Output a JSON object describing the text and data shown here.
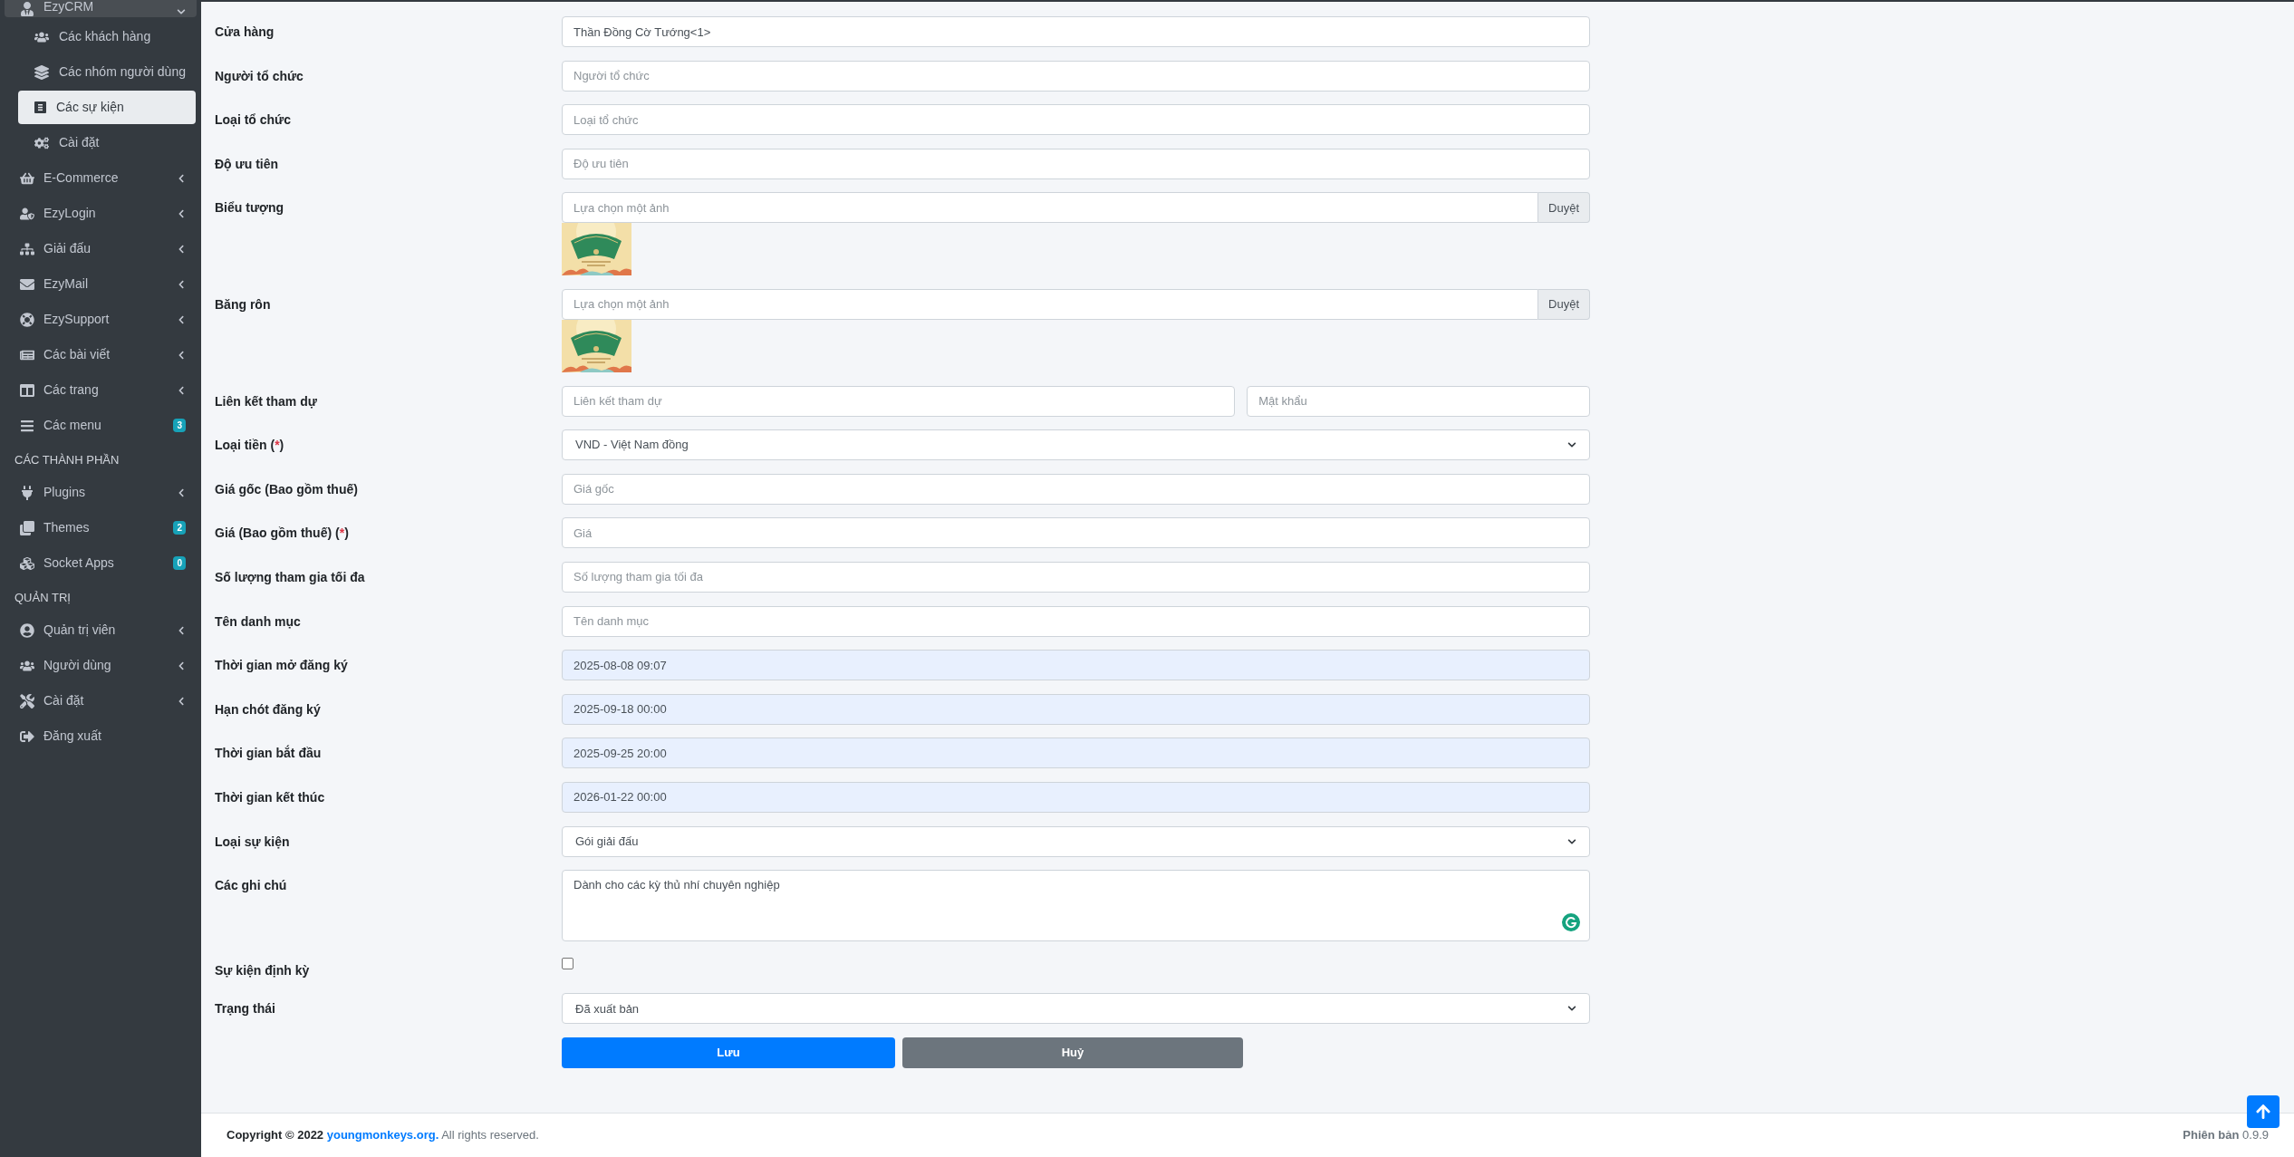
{
  "sidebar": {
    "items": [
      {
        "kind": "group",
        "label": "EzyCRM",
        "expanded": true
      },
      {
        "kind": "sub",
        "label": "Các khách hàng",
        "selected": false
      },
      {
        "kind": "sub",
        "label": "Các nhóm người dùng",
        "selected": false
      },
      {
        "kind": "sub",
        "label": "Các sự kiện",
        "selected": true
      },
      {
        "kind": "sub",
        "label": "Cài đặt",
        "selected": false
      },
      {
        "kind": "group",
        "label": "E-Commerce",
        "expanded": false
      },
      {
        "kind": "group",
        "label": "EzyLogin",
        "expanded": false
      },
      {
        "kind": "group",
        "label": "Giải đấu",
        "expanded": false
      },
      {
        "kind": "group",
        "label": "EzyMail",
        "expanded": false
      },
      {
        "kind": "group",
        "label": "EzySupport",
        "expanded": false
      },
      {
        "kind": "group",
        "label": "Các bài viết",
        "expanded": false
      },
      {
        "kind": "group",
        "label": "Các trang",
        "expanded": false
      },
      {
        "kind": "link",
        "label": "Các menu",
        "badge": "3"
      },
      {
        "kind": "header",
        "label": "CÁC THÀNH PHẦN"
      },
      {
        "kind": "group",
        "label": "Plugins",
        "expanded": false
      },
      {
        "kind": "link",
        "label": "Themes",
        "badge": "2"
      },
      {
        "kind": "link",
        "label": "Socket Apps",
        "badge": "0"
      },
      {
        "kind": "header",
        "label": "QUẢN TRỊ"
      },
      {
        "kind": "group",
        "label": "Quản trị viên",
        "expanded": false
      },
      {
        "kind": "group",
        "label": "Người dùng",
        "expanded": false
      },
      {
        "kind": "group",
        "label": "Cài đặt",
        "expanded": false
      },
      {
        "kind": "link",
        "label": "Đăng xuất"
      }
    ]
  },
  "form": {
    "fields": [
      {
        "kind": "text",
        "label": "Cửa hàng",
        "value": "Thần Đồng Cờ Tướng<1>"
      },
      {
        "kind": "text",
        "label": "Người tổ chức",
        "placeholder": "Người tổ chức"
      },
      {
        "kind": "text",
        "label": "Loại tổ chức",
        "placeholder": "Loại tổ chức"
      },
      {
        "kind": "text",
        "label": "Độ ưu tiên",
        "placeholder": "Độ ưu tiên"
      },
      {
        "label": "Biểu tượng",
        "placeholder": "Lựa chọn một ảnh",
        "button": "Duyệt"
      },
      {
        "label": "Băng rôn",
        "placeholder": "Lựa chọn một ảnh",
        "button": "Duyệt"
      },
      {
        "kind": "pair",
        "label": "Liên kết tham dự",
        "inputs": [
          {
            "placeholder": "Liên kết tham dự"
          },
          {
            "placeholder": "Mật khẩu"
          }
        ]
      },
      {
        "kind": "select",
        "label": "Loại tiền",
        "required": {
          "open": "(",
          "mark": "*",
          "close": ")"
        },
        "value": "VND - Việt Nam đồng"
      },
      {
        "kind": "text",
        "label": "Giá gốc (Bao gồm thuế)",
        "placeholder": "Giá gốc"
      },
      {
        "kind": "text",
        "label": "Giá (Bao gồm thuế)",
        "required": {
          "open": "(",
          "mark": "*",
          "close": ")"
        },
        "placeholder": "Giá"
      },
      {
        "kind": "text",
        "label": "Số lượng tham gia tối đa",
        "placeholder": "Số lượng tham gia tối đa"
      },
      {
        "kind": "text",
        "label": "Tên danh mục",
        "placeholder": "Tên danh mục"
      },
      {
        "kind": "date",
        "label": "Thời gian mở đăng ký",
        "value": "2025-08-08 09:07"
      },
      {
        "kind": "date",
        "label": "Hạn chót đăng ký",
        "value": "2025-09-18 00:00"
      },
      {
        "kind": "date",
        "label": "Thời gian bắt đầu",
        "value": "2025-09-25 20:00"
      },
      {
        "kind": "date",
        "label": "Thời gian kết thúc",
        "value": "2026-01-22 00:00"
      },
      {
        "kind": "select",
        "label": "Loại sự kiện",
        "value": "Gói giải đấu"
      },
      {
        "kind": "textarea",
        "label": "Các ghi chú",
        "value": "Dành cho các kỳ thủ nhí chuyên nghiệp"
      },
      {
        "kind": "checkbox",
        "label": "Sự kiện định kỳ",
        "checked": false
      },
      {
        "kind": "select",
        "label": "Trạng thái",
        "value": "Đã xuất bản"
      }
    ],
    "buttons": [
      {
        "kind": "primary",
        "label": "Lưu"
      },
      {
        "kind": "secondary",
        "label": "Huỷ"
      }
    ]
  },
  "footer": {
    "copyright_prefix": "Copyright © 2022",
    "link": "youngmonkeys.org.",
    "copyright_suffix": "All rights reserved.",
    "version_label": "Phiên bản",
    "version": "0.9.9"
  }
}
